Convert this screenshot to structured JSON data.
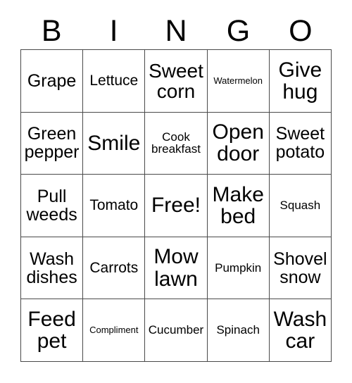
{
  "header": {
    "letters": [
      "B",
      "I",
      "N",
      "G",
      "O"
    ]
  },
  "grid": {
    "rows": 5,
    "columns": 5,
    "border_color": "#4a4a4a",
    "background_color": "#ffffff",
    "text_color": "#000000",
    "cells": [
      {
        "text": "Grape",
        "size": "md"
      },
      {
        "text": "Lettuce",
        "size": "sm"
      },
      {
        "text": "Sweet\ncorn",
        "size": "lg"
      },
      {
        "text": "Watermelon",
        "size": "xxs"
      },
      {
        "text": "Give\nhug",
        "size": "xl"
      },
      {
        "text": "Green\npepper",
        "size": "md"
      },
      {
        "text": "Smile",
        "size": "xl"
      },
      {
        "text": "Cook\nbreakfast",
        "size": "xs"
      },
      {
        "text": "Open\ndoor",
        "size": "xl"
      },
      {
        "text": "Sweet\npotato",
        "size": "md"
      },
      {
        "text": "Pull\nweeds",
        "size": "md"
      },
      {
        "text": "Tomato",
        "size": "sm"
      },
      {
        "text": "Free!",
        "size": "xl"
      },
      {
        "text": "Make\nbed",
        "size": "xl"
      },
      {
        "text": "Squash",
        "size": "xs"
      },
      {
        "text": "Wash\ndishes",
        "size": "md"
      },
      {
        "text": "Carrots",
        "size": "sm"
      },
      {
        "text": "Mow\nlawn",
        "size": "xl"
      },
      {
        "text": "Pumpkin",
        "size": "xs"
      },
      {
        "text": "Shovel\nsnow",
        "size": "md"
      },
      {
        "text": "Feed\npet",
        "size": "xl"
      },
      {
        "text": "Compliment",
        "size": "xxs"
      },
      {
        "text": "Cucumber",
        "size": "xs"
      },
      {
        "text": "Spinach",
        "size": "xs"
      },
      {
        "text": "Wash\ncar",
        "size": "xl"
      }
    ]
  }
}
